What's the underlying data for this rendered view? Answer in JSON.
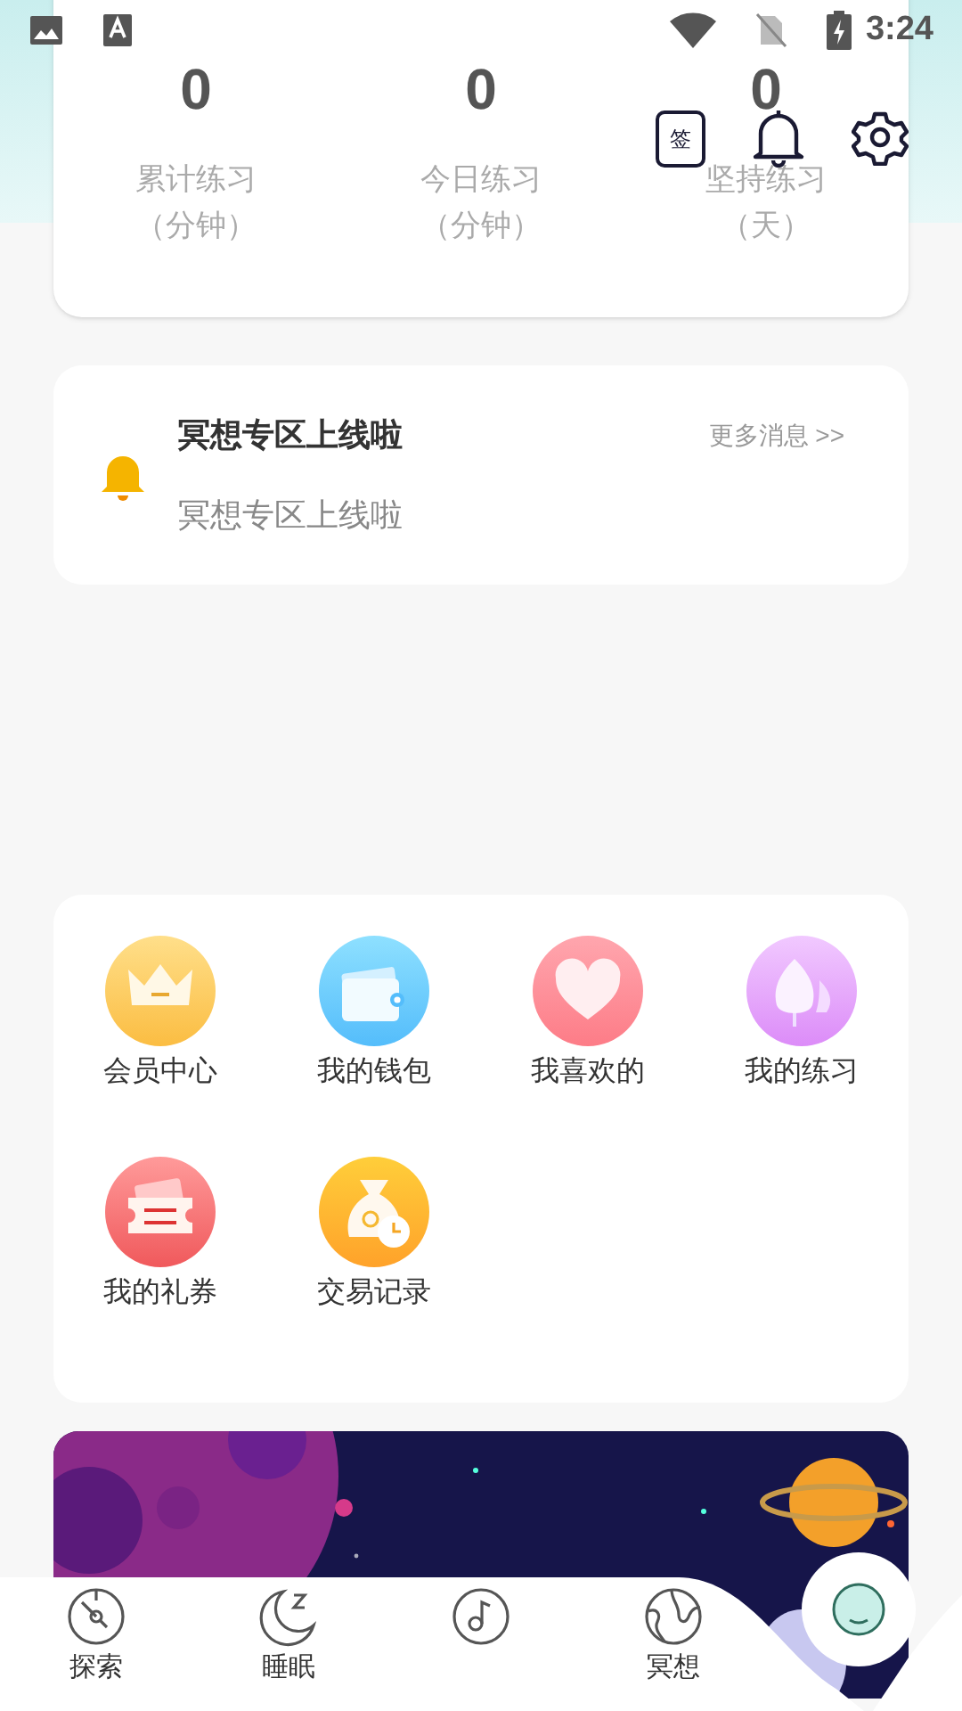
{
  "status_bar": {
    "time": "3:24"
  },
  "stats": [
    {
      "value": "0",
      "label": "累计练习",
      "unit": "（分钟）"
    },
    {
      "value": "0",
      "label": "今日练习",
      "unit": "（分钟）"
    },
    {
      "value": "0",
      "label": "坚持练习",
      "unit": "（天）"
    }
  ],
  "toolbar": {
    "sign_in_label": "签"
  },
  "notice": {
    "title": "冥想专区上线啦",
    "more": "更多消息 >>",
    "message": "冥想专区上线啦"
  },
  "menu": [
    {
      "label": "会员中心",
      "kind": "crown"
    },
    {
      "label": "我的钱包",
      "kind": "wallet"
    },
    {
      "label": "我喜欢的",
      "kind": "heart"
    },
    {
      "label": "我的练习",
      "kind": "leaf"
    },
    {
      "label": "我的礼券",
      "kind": "ticket"
    },
    {
      "label": "交易记录",
      "kind": "moneybag"
    }
  ],
  "nav": [
    {
      "label": "探索",
      "kind": "compass"
    },
    {
      "label": "睡眠",
      "kind": "moon"
    },
    {
      "kind": "music"
    },
    {
      "label": "冥想",
      "kind": "globe"
    },
    {
      "kind": "face"
    }
  ]
}
